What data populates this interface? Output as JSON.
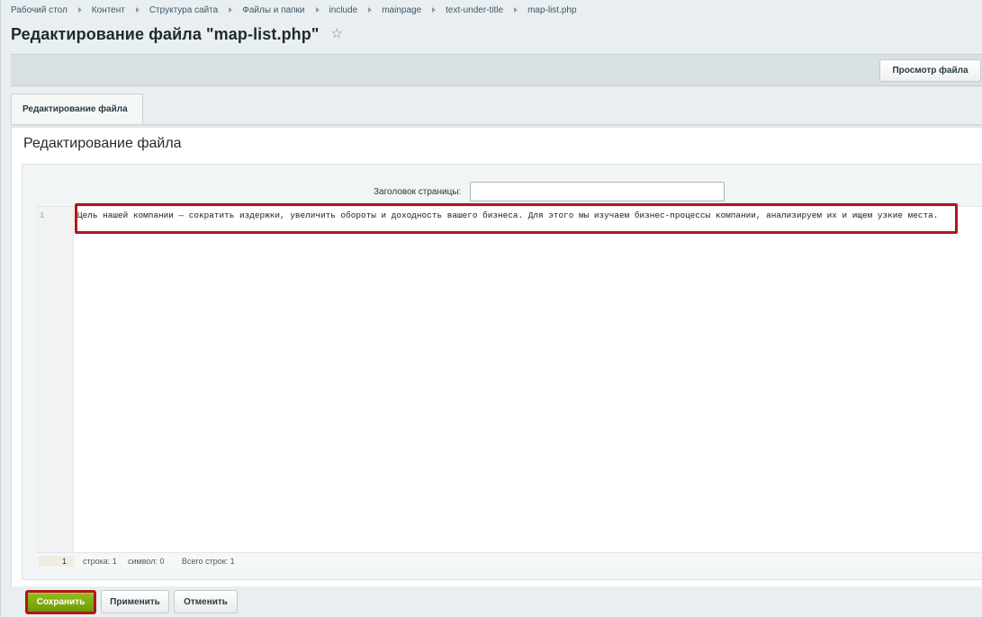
{
  "breadcrumbs": [
    "Рабочий стол",
    "Контент",
    "Структура сайта",
    "Файлы и папки",
    "include",
    "mainpage",
    "text-under-title",
    "map-list.php"
  ],
  "page": {
    "title": "Редактирование файла \"map-list.php\"",
    "favorite_icon": "star-icon"
  },
  "toolbar": {
    "view_file_label": "Просмотр файла"
  },
  "tabs": [
    {
      "label": "Редактирование файла",
      "active": true
    }
  ],
  "panel": {
    "heading": "Редактирование файла",
    "page_heading_label": "Заголовок страницы:",
    "page_heading_value": "",
    "editor": {
      "line_numbers": [
        "1"
      ],
      "lines": [
        "Цель нашей компании — сократить издержки, увеличить обороты и доходность вашего бизнеса. Для этого мы изучаем бизнес-процессы компании, анализируем их и ищем узкие места."
      ],
      "status": {
        "current_line": "1",
        "row_text": "строка: 1",
        "symbol_text": "символ: 0",
        "total_text": "Всего строк: 1"
      }
    }
  },
  "buttons": {
    "save_label": "Сохранить",
    "apply_label": "Применить",
    "cancel_label": "Отменить"
  },
  "colors": {
    "highlight": "#b0171b",
    "save_green": "#7fa90f",
    "background": "#e9eef0"
  }
}
